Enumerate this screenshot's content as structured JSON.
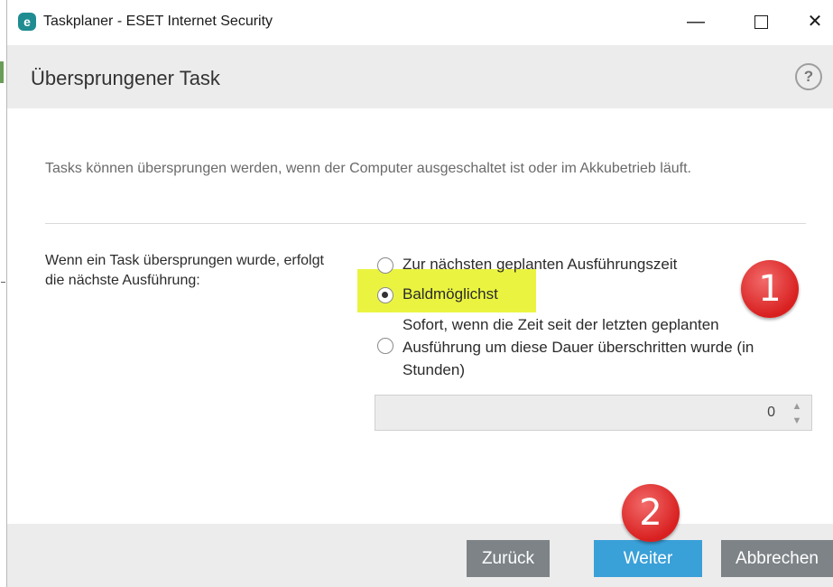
{
  "window": {
    "title": "Taskplaner - ESET Internet Security",
    "app_icon_letter": "e",
    "controls": {
      "minimize": "—",
      "close": "✕"
    }
  },
  "header": {
    "title": "Übersprungener Task",
    "help": "?"
  },
  "description": "Tasks können übersprungen werden, wenn der Computer ausgeschaltet ist oder im Akkubetrieb läuft.",
  "form": {
    "label": "Wenn ein Task übersprungen wurde, erfolgt die nächste Ausführung:",
    "options": [
      {
        "label": "Zur nächsten geplanten Ausführungszeit",
        "checked": false
      },
      {
        "label": "Baldmöglichst",
        "checked": true
      },
      {
        "label": "Sofort, wenn die Zeit seit der letzten geplanten Ausführung um diese Dauer überschritten wurde (in Stunden)",
        "checked": false
      }
    ],
    "hours_value": "0"
  },
  "footer": {
    "back": "Zurück",
    "next": "Weiter",
    "cancel": "Abbrechen"
  },
  "annotations": {
    "badge1": "1",
    "badge2": "2"
  },
  "colors": {
    "highlight": "#eaf440",
    "primary_button": "#3aa0d8",
    "secondary_button": "#7d8387",
    "badge": "#d92020"
  }
}
